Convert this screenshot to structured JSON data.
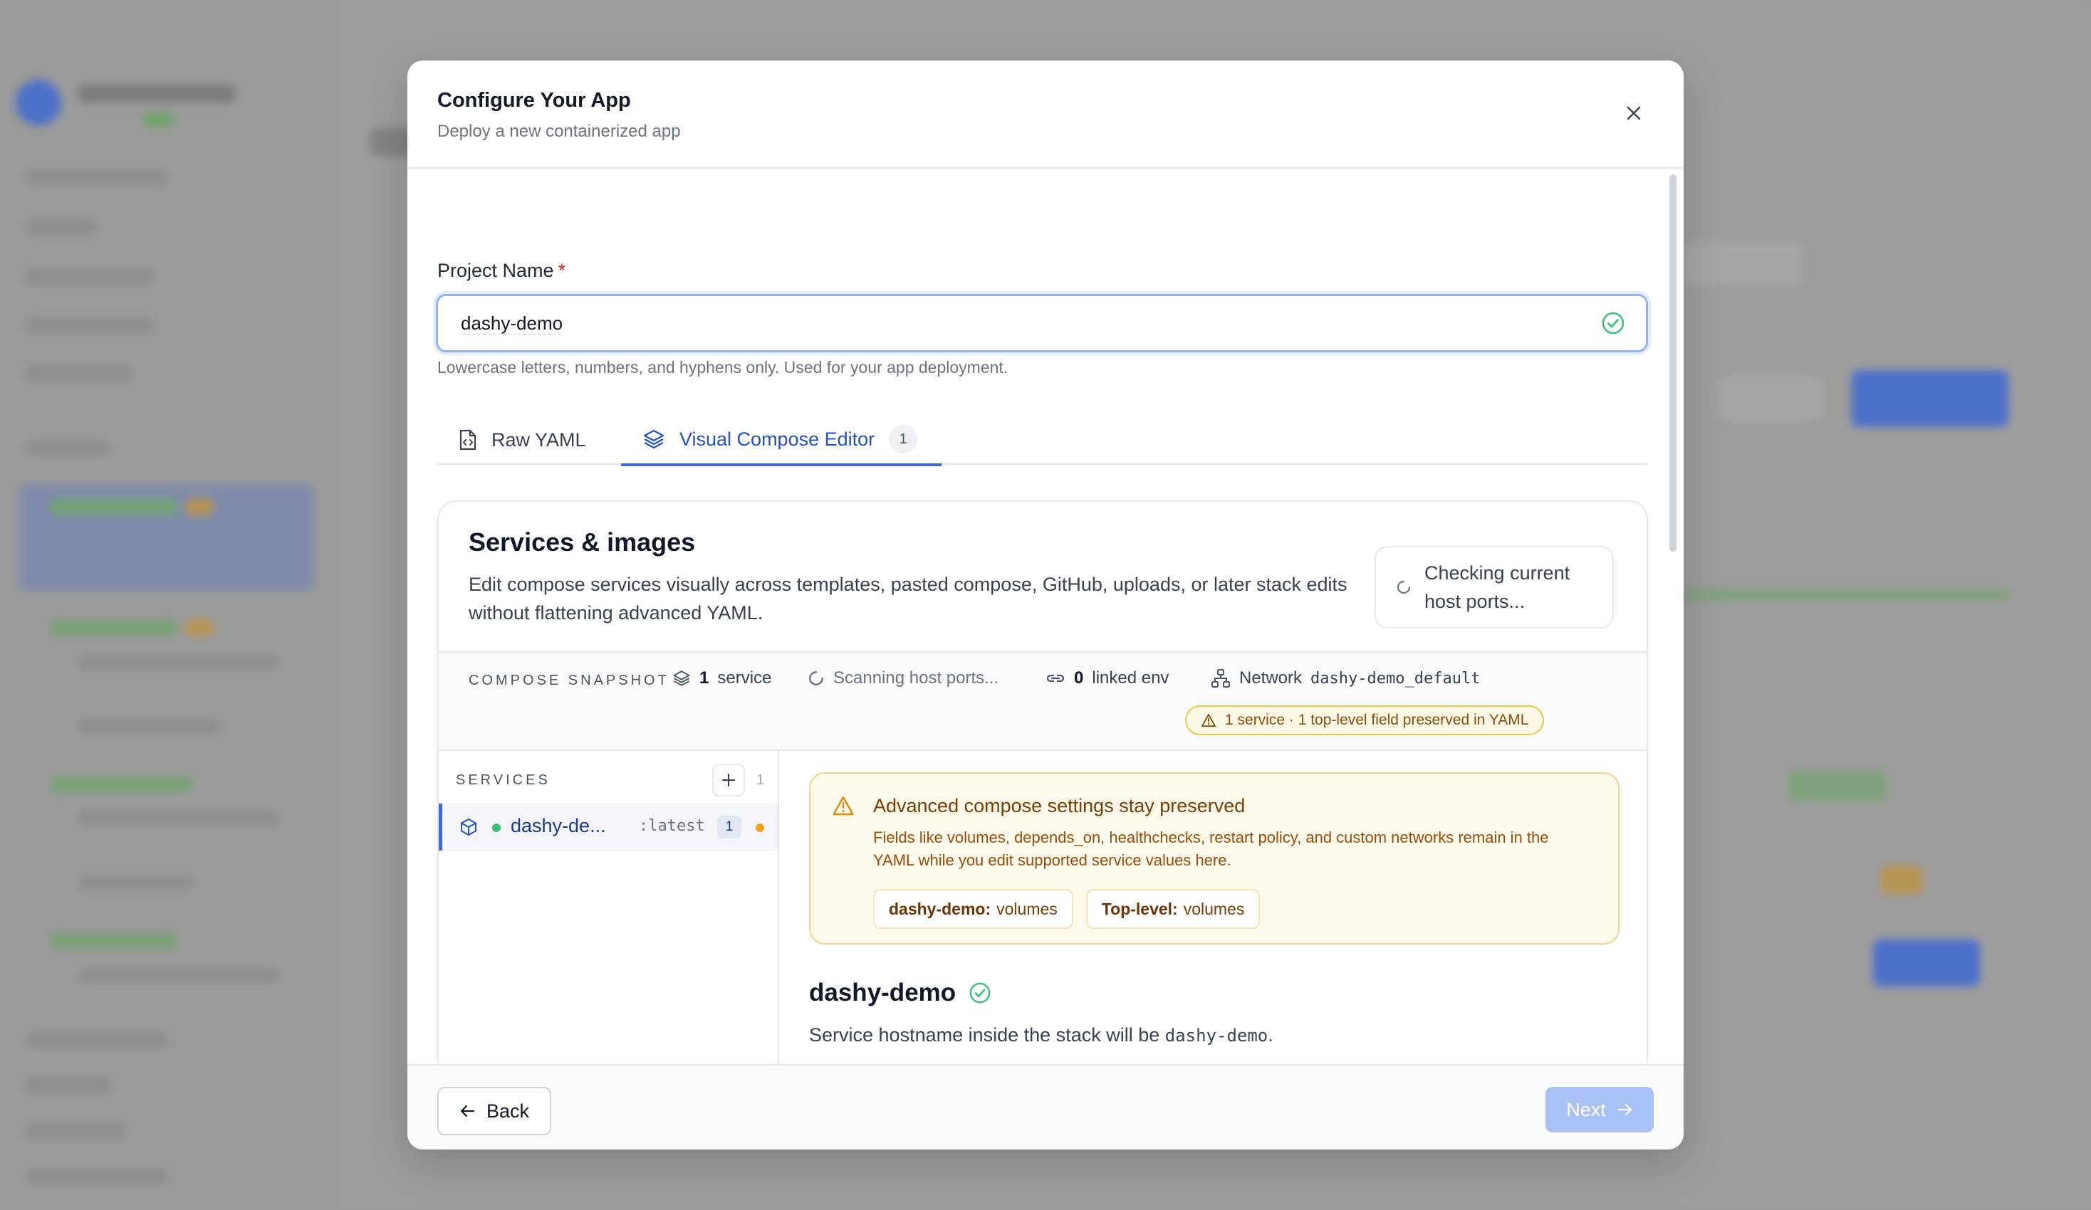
{
  "modal": {
    "title": "Configure Your App",
    "subtitle": "Deploy a new containerized app"
  },
  "project_name": {
    "label": "Project Name",
    "required_marker": "*",
    "value": "dashy-demo",
    "helper": "Lowercase letters, numbers, and hyphens only. Used for your app deployment."
  },
  "tabs": [
    {
      "label": "Raw YAML",
      "icon": "file-code-icon",
      "active": false
    },
    {
      "label": "Visual Compose Editor",
      "icon": "layers-icon",
      "active": true,
      "badge": "1"
    }
  ],
  "services_card": {
    "title": "Services & images",
    "description": "Edit compose services visually across templates, pasted compose, GitHub, uploads, or later stack edits without flattening advanced YAML.",
    "port_check": "Checking current host ports..."
  },
  "snapshot": {
    "label": "COMPOSE SNAPSHOT",
    "service_count": "1",
    "service_word": "service",
    "scanning": "Scanning host ports...",
    "linked_env_count": "0",
    "linked_env_word": "linked env",
    "network_label": "Network",
    "network_value": "dashy-demo_default",
    "preserved_pill": "1 service · 1 top-level field preserved in YAML"
  },
  "services_list": {
    "label": "SERVICES",
    "count": "1",
    "items": [
      {
        "name": "dashy-de...",
        "tag": ":latest",
        "badge": "1",
        "status_color": "#3bbf7a",
        "warning_color": "#f0a414"
      }
    ]
  },
  "advanced_warning": {
    "title": "Advanced compose settings stay preserved",
    "text": "Fields like volumes, depends_on, healthchecks, restart policy, and custom networks remain in the YAML while you edit supported service values here.",
    "chips": [
      {
        "key": "dashy-demo:",
        "value": "volumes"
      },
      {
        "key": "Top-level:",
        "value": "volumes"
      }
    ]
  },
  "service_detail": {
    "name": "dashy-demo",
    "hostname_prefix": "Service hostname inside the stack will be",
    "hostname_value": "dashy-demo",
    "hostname_suffix": "."
  },
  "footer": {
    "back_label": "Back",
    "next_label": "Next"
  },
  "colors": {
    "accent": "#3a6ad6",
    "success": "#3bbf7a",
    "warning": "#f0a414",
    "next_disabled": "#a9c1f5"
  }
}
